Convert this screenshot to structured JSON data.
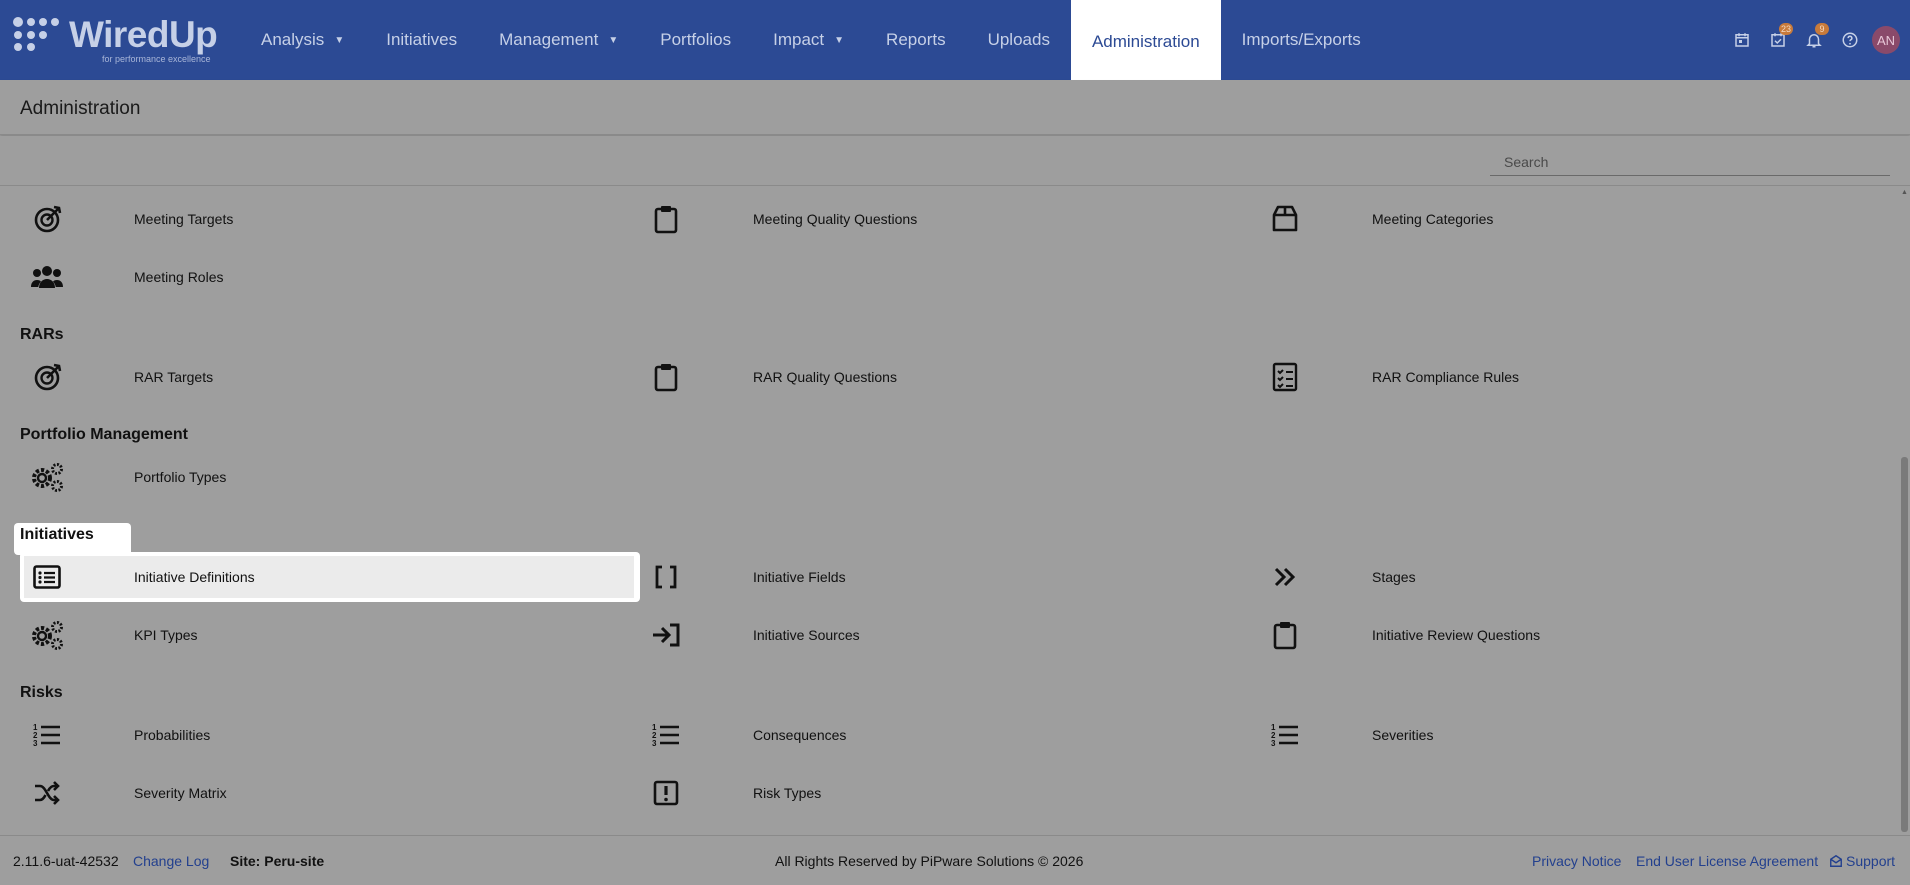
{
  "logo": {
    "name": "WiredUp",
    "tagline": "for performance excellence"
  },
  "nav": {
    "items": [
      {
        "label": "Analysis",
        "dropdown": true
      },
      {
        "label": "Initiatives",
        "dropdown": false
      },
      {
        "label": "Management",
        "dropdown": true
      },
      {
        "label": "Portfolios",
        "dropdown": false
      },
      {
        "label": "Impact",
        "dropdown": true
      },
      {
        "label": "Reports",
        "dropdown": false
      },
      {
        "label": "Uploads",
        "dropdown": false
      },
      {
        "label": "Administration",
        "dropdown": false,
        "active": true
      },
      {
        "label": "Imports/Exports",
        "dropdown": false
      }
    ],
    "tasks_badge": "23",
    "notifications_badge": "9",
    "avatar_initials": "AN"
  },
  "page": {
    "title": "Administration"
  },
  "search": {
    "placeholder": "Search"
  },
  "sections": {
    "meetings": {
      "items": [
        "Meeting Targets",
        "Meeting Quality Questions",
        "Meeting Categories",
        "Meeting Roles"
      ]
    },
    "rars": {
      "title": "RARs",
      "items": [
        "RAR Targets",
        "RAR Quality Questions",
        "RAR Compliance Rules"
      ]
    },
    "portfolio": {
      "title": "Portfolio Management",
      "items": [
        "Portfolio Types"
      ]
    },
    "initiatives": {
      "title": "Initiatives",
      "items": [
        "Initiative Definitions",
        "Initiative Fields",
        "Stages",
        "KPI Types",
        "Initiative Sources",
        "Initiative Review Questions"
      ]
    },
    "risks": {
      "title": "Risks",
      "items": [
        "Probabilities",
        "Consequences",
        "Severities",
        "Severity Matrix",
        "Risk Types"
      ]
    }
  },
  "footer": {
    "version": "2.11.6-uat-42532",
    "change_log": "Change Log",
    "site": "Site: Peru-site",
    "copyright": "All Rights Reserved by PiPware Solutions © 2026",
    "privacy": "Privacy Notice",
    "eula": "End User License Agreement",
    "support": "Support"
  },
  "colors": {
    "nav_bg": "#2c4a94",
    "overlay_bg": "#9e9e9e",
    "link": "#23408e",
    "highlight": "#ffffff"
  }
}
